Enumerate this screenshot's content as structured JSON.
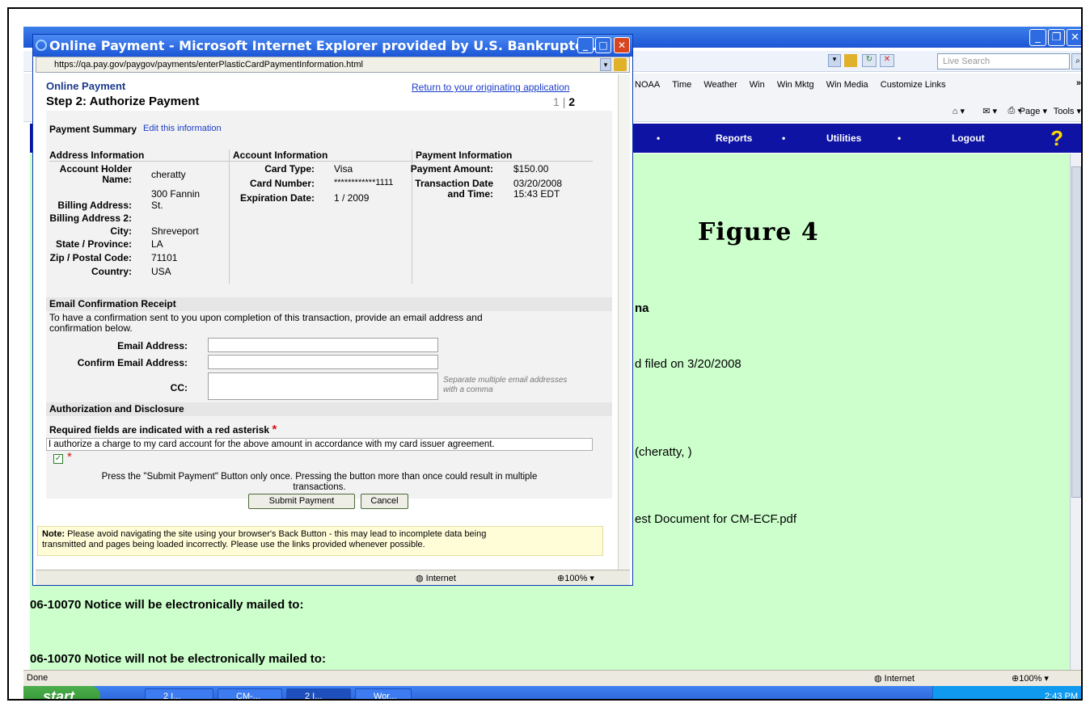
{
  "bg_browser": {
    "search_placeholder": "Live Search",
    "links": [
      "NOAA",
      "Time",
      "Weather",
      "Win",
      "Win Mktg",
      "Win Media",
      "Customize Links"
    ],
    "cmd_items": [
      "Page ▾",
      "Tools ▾"
    ],
    "nav": [
      "Reports",
      "Utilities",
      "Logout"
    ],
    "figure_label": "Figure 4",
    "content_lines": {
      "state_frag": "na",
      "filed": "d filed on 3/20/2008",
      "party": "(cheratty, )",
      "doc": "est Document for CM-ECF.pdf",
      "mailed": "06-10070 Notice will be electronically mailed to:",
      "not_mailed": "06-10070 Notice will not be electronically mailed to:"
    },
    "status_done": "Done",
    "status_zone": "Internet",
    "status_zoom": "100%"
  },
  "taskbar": {
    "start": "start",
    "tasks": [
      "2 I...",
      "CM-...",
      "2 I...",
      "Wor..."
    ],
    "clock": "2:43 PM"
  },
  "popup": {
    "title": "Online Payment - Microsoft Internet Explorer provided by U.S. Bankruptc...",
    "url": "https://qa.pay.gov/paygov/payments/enterPlasticCardPaymentInformation.html",
    "header": "Online Payment",
    "return_link": "Return to your originating application",
    "step": "Step 2: Authorize Payment",
    "steps_done": "1",
    "steps_sep": "|",
    "steps_current": "2",
    "summary_title": "Payment Summary",
    "edit_link": "Edit this information",
    "address": {
      "heading": "Address Information",
      "holder_label1": "Account Holder",
      "holder_label2": "Name:",
      "holder": "cheratty",
      "billing_label": "Billing Address:",
      "billing1": "300 Fannin",
      "billing2": "St.",
      "billing2_label": "Billing Address 2:",
      "city_label": "City:",
      "city": "Shreveport",
      "state_label": "State / Province:",
      "state": "LA",
      "zip_label": "Zip / Postal Code:",
      "zip": "71101",
      "country_label": "Country:",
      "country": "USA"
    },
    "account": {
      "heading": "Account Information",
      "type_label": "Card Type:",
      "type": "Visa",
      "number_label": "Card Number:",
      "number": "************1111",
      "exp_label": "Expiration Date:",
      "exp": "1 / 2009"
    },
    "payment": {
      "heading": "Payment Information",
      "amount_label": "Payment Amount:",
      "amount": "$150.00",
      "tdate_label1": "Transaction Date",
      "tdate_label2": "and Time:",
      "tdate": "03/20/2008",
      "ttime": "15:43 EDT"
    },
    "email": {
      "heading": "Email Confirmation Receipt",
      "desc1": "To have a confirmation sent to you upon completion of this transaction, provide an email address and",
      "desc2": "confirmation below.",
      "email_label": "Email Address:",
      "confirm_label": "Confirm Email Address:",
      "cc_label": "CC:",
      "cc_hint1": "Separate multiple email addresses",
      "cc_hint2": "with a comma"
    },
    "auth": {
      "heading": "Authorization and Disclosure",
      "required": "Required fields are indicated with a red asterisk",
      "asterisk": "*",
      "statement": "I authorize a charge to my card account for the above amount in accordance with my card issuer agreement.",
      "press1": "Press the \"Submit Payment\" Button only once. Pressing the button more than once could result in multiple",
      "press2": "transactions.",
      "submit": "Submit Payment",
      "cancel": "Cancel"
    },
    "note_bold": "Note:",
    "note_text": " Please avoid navigating the site using your browser's Back Button - this may lead to incomplete data being",
    "note_text2": "transmitted and pages being loaded incorrectly. Please use the links provided whenever possible.",
    "status_zone": "Internet",
    "status_zoom": "100%"
  }
}
